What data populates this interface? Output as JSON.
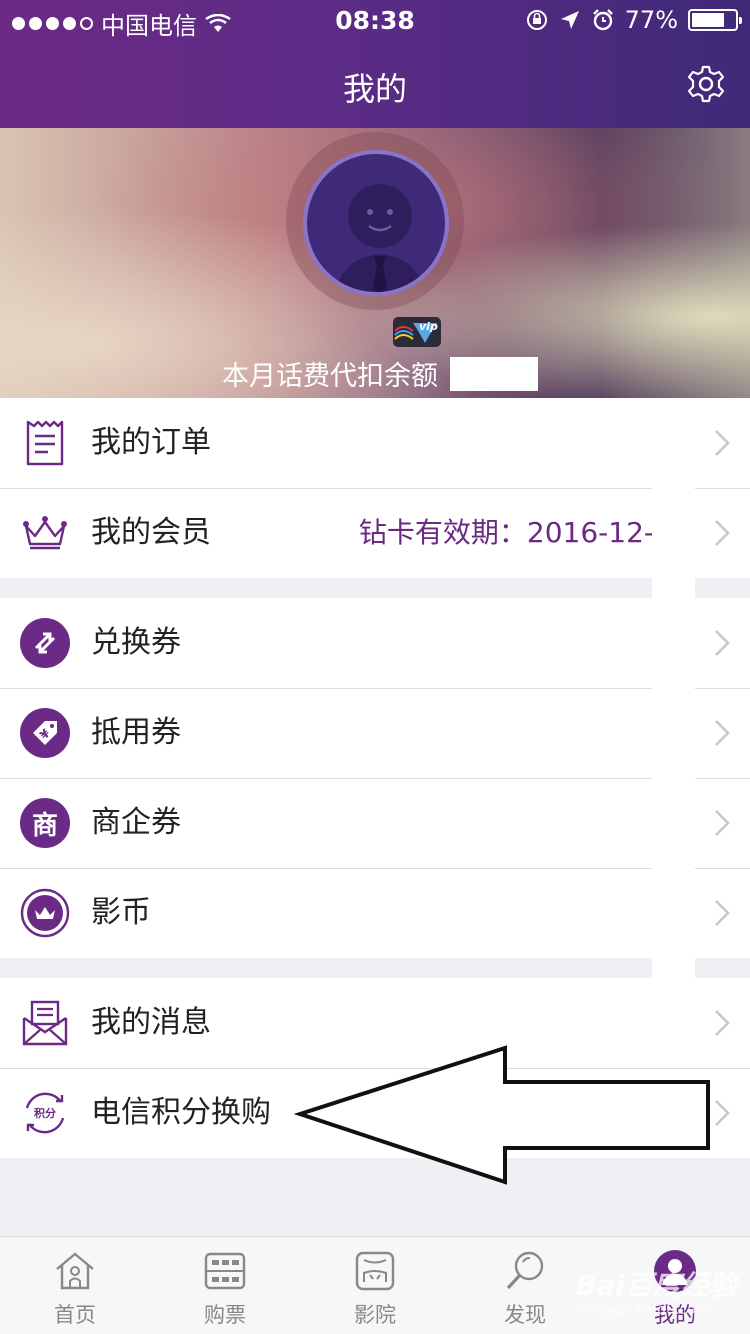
{
  "status_bar": {
    "carrier": "中国电信",
    "time": "08:38",
    "battery_percent": "77%",
    "battery_level": 0.77
  },
  "nav": {
    "title": "我的",
    "settings_icon": "gear-icon"
  },
  "profile": {
    "vip_badge": "vip",
    "balance_label": "本月话费代扣余额"
  },
  "groups": {
    "account": [
      {
        "label": "我的订单",
        "icon": "receipt-icon"
      },
      {
        "label": "我的会员",
        "icon": "crown-icon",
        "value": "钻卡有效期：2016-12-"
      }
    ],
    "coupons": [
      {
        "label": "兑换券",
        "icon": "exchange-icon"
      },
      {
        "label": "抵用券",
        "icon": "yen-tag-icon"
      },
      {
        "label": "商企券",
        "icon": "shang-icon",
        "glyph": "商"
      },
      {
        "label": "影币",
        "icon": "crown-coin-icon"
      }
    ],
    "other": [
      {
        "label": "我的消息",
        "icon": "envelope-icon"
      },
      {
        "label": "电信积分换购",
        "icon": "points-exchange-icon",
        "glyph": "积分"
      }
    ]
  },
  "tabbar": [
    {
      "label": "首页",
      "icon": "home-icon"
    },
    {
      "label": "购票",
      "icon": "ticket-icon"
    },
    {
      "label": "影院",
      "icon": "cinema-icon"
    },
    {
      "label": "发现",
      "icon": "search-icon"
    },
    {
      "label": "我的",
      "icon": "profile-icon",
      "active": true
    }
  ],
  "watermark": {
    "text": "Bai百度经验",
    "sub": "jingyan.baidu.com"
  },
  "colors": {
    "brand": "#6b2a86",
    "header_gradient_end": "#3f2a78"
  }
}
